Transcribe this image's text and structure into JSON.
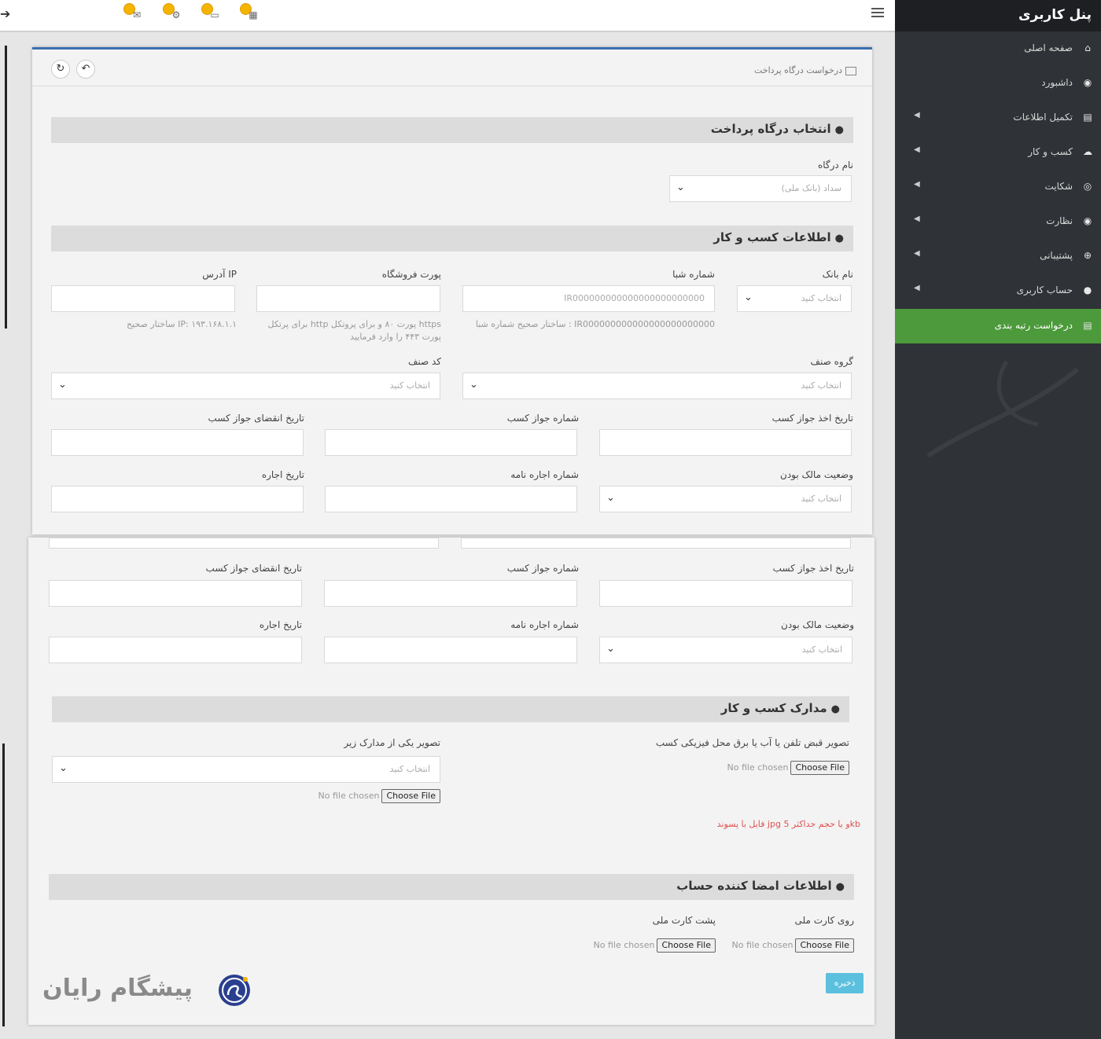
{
  "sidebar": {
    "title": "پنل کاربری",
    "items": [
      {
        "label": "صفحه اصلی",
        "icon": "home-icon",
        "glyph": "⌂",
        "caret": false,
        "active": false
      },
      {
        "label": "داشبورد",
        "icon": "dashboard-icon",
        "glyph": "◉",
        "caret": false,
        "active": false
      },
      {
        "label": "تکمیل اطلاعات",
        "icon": "id-card-icon",
        "glyph": "▤",
        "caret": true,
        "active": false
      },
      {
        "label": "کسب و کار",
        "icon": "cloud-icon",
        "glyph": "☁",
        "caret": true,
        "active": false
      },
      {
        "label": "شکایت",
        "icon": "globe-icon",
        "glyph": "◎",
        "caret": true,
        "active": false
      },
      {
        "label": "نظارت",
        "icon": "eye-icon",
        "glyph": "◉",
        "caret": true,
        "active": false
      },
      {
        "label": "پشتیبانی",
        "icon": "plus-circle-icon",
        "glyph": "⊕",
        "caret": true,
        "active": false
      },
      {
        "label": "حساب کاربری",
        "icon": "user-icon",
        "glyph": "●",
        "caret": true,
        "active": false
      },
      {
        "label": "درخواست رتبه بندی",
        "icon": "id-card-icon",
        "glyph": "▤",
        "caret": false,
        "active": true
      }
    ],
    "active_color": "#4c9a3b"
  },
  "breadcrumb": "درخواست درگاه پرداخت",
  "sections": {
    "gateway": "انتخاب درگاه پرداخت",
    "business": "اطلاعات کسب و کار",
    "documents": "مدارک کسب و کار",
    "signer": "اطلاعات امضا کننده حساب"
  },
  "fields": {
    "gateway_name": {
      "label": "نام درگاه",
      "placeholder": "سداد (بانک ملی)"
    },
    "bank_name": {
      "label": "نام بانک",
      "placeholder": "انتخاب کنید"
    },
    "sheba": {
      "label": "شماره شبا",
      "placeholder": "IR000000000000000000000000",
      "hint": "ساختار صحیح شماره شبا : IR000000000000000000000000"
    },
    "store_port": {
      "label": "پورت فروشگاه",
      "hint": "برای پرتکل http پورت ۸۰ و برای پروتکل https پورت ۴۴۳ را وارد فرمایید"
    },
    "ip_address": {
      "label": "آدرس IP",
      "hint": "ساختار صحیح IP: ۱۹۳.۱۶۸.۱.۱"
    },
    "guild_group": {
      "label": "گروه صنف",
      "placeholder": "انتخاب کنید"
    },
    "guild_code": {
      "label": "کد صنف",
      "placeholder": "انتخاب کنید"
    },
    "license_issue_date": {
      "label": "تاریخ اخذ جواز کسب"
    },
    "license_number": {
      "label": "شماره جواز کسب"
    },
    "license_expiry_date": {
      "label": "تاریخ انقضای جواز کسب"
    },
    "ownership_status": {
      "label": "وضعیت مالک بودن",
      "placeholder": "انتخاب کنید"
    },
    "lease_number": {
      "label": "شماره اجاره نامه"
    },
    "lease_date": {
      "label": "تاریخ اجاره"
    },
    "bill_image": {
      "label": "تصویر قبض تلفن یا آب یا برق محل فیزیکی کسب"
    },
    "doc_image": {
      "label": "تصویر یکی از مدارک زیر",
      "placeholder": "انتخاب کنید"
    },
    "file_error": "فایل با پسوند jpg و یا حجم حداکثر 5kb",
    "id_front": {
      "label": "روی کارت ملی"
    },
    "id_back": {
      "label": "پشت کارت ملی"
    }
  },
  "file_input": {
    "button": "Choose File",
    "status": "No file chosen"
  },
  "save_button": "ذخیره",
  "watermark": "پیشگام رایان"
}
